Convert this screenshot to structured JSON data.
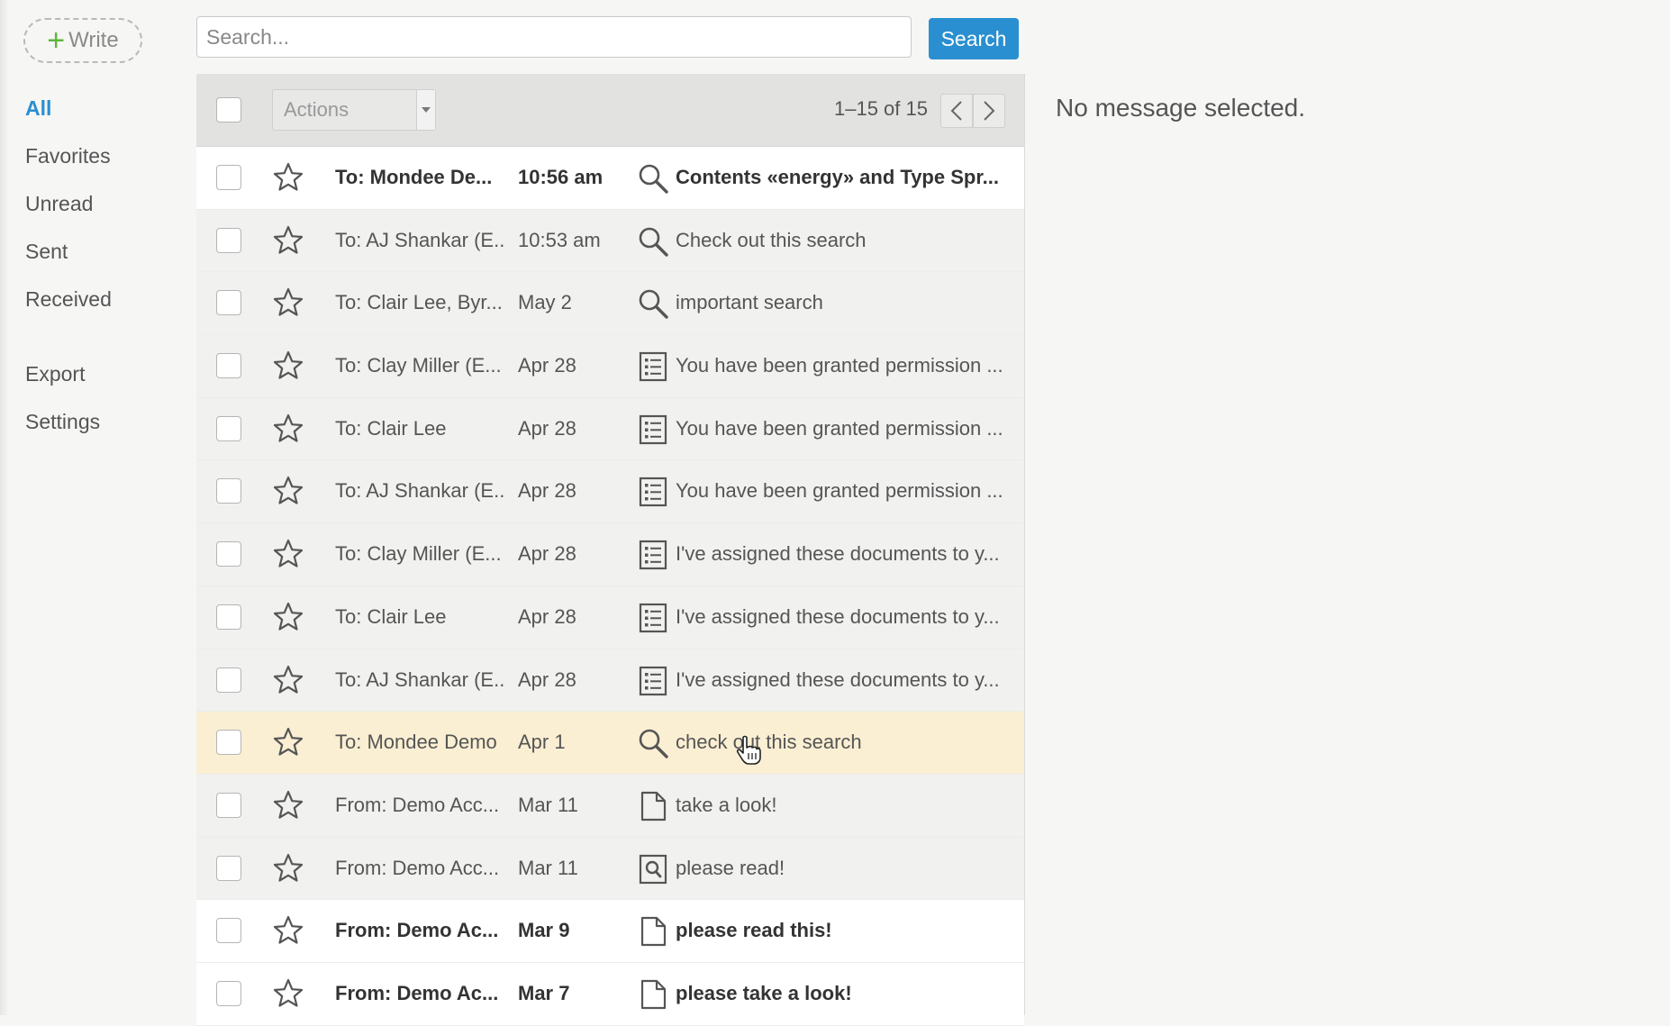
{
  "compose": {
    "label": "Write"
  },
  "search": {
    "placeholder": "Search...",
    "button_label": "Search"
  },
  "sidebar": {
    "items": [
      {
        "label": "All",
        "active": true
      },
      {
        "label": "Favorites"
      },
      {
        "label": "Unread"
      },
      {
        "label": "Sent"
      },
      {
        "label": "Received"
      }
    ],
    "secondary": [
      {
        "label": "Export"
      },
      {
        "label": "Settings"
      }
    ]
  },
  "toolbar": {
    "actions_label": "Actions",
    "pager_text": "1–15 of 15"
  },
  "messages": [
    {
      "who": "To: Mondee De...",
      "when": "10:56 am",
      "icon": "search-icon",
      "subject": "Contents «energy» and Type Spr...",
      "unread": true
    },
    {
      "who": "To: AJ Shankar (E...",
      "when": "10:53 am",
      "icon": "search-icon",
      "subject": "Check out this search"
    },
    {
      "who": "To: Clair Lee, Byr...",
      "when": "May 2",
      "icon": "search-icon",
      "subject": "important search"
    },
    {
      "who": "To: Clay Miller (E...",
      "when": "Apr 28",
      "icon": "list-icon",
      "subject": "You have been granted permission ..."
    },
    {
      "who": "To: Clair Lee",
      "when": "Apr 28",
      "icon": "list-icon",
      "subject": "You have been granted permission ..."
    },
    {
      "who": "To: AJ Shankar (E...",
      "when": "Apr 28",
      "icon": "list-icon",
      "subject": "You have been granted permission ..."
    },
    {
      "who": "To: Clay Miller (E...",
      "when": "Apr 28",
      "icon": "list-icon",
      "subject": "I've assigned these documents to y..."
    },
    {
      "who": "To: Clair Lee",
      "when": "Apr 28",
      "icon": "list-icon",
      "subject": "I've assigned these documents to y..."
    },
    {
      "who": "To: AJ Shankar (E...",
      "when": "Apr 28",
      "icon": "list-icon",
      "subject": "I've assigned these documents to y..."
    },
    {
      "who": "To: Mondee Demo",
      "when": "Apr 1",
      "icon": "search-icon",
      "subject": "check out this search",
      "hover": true
    },
    {
      "who": "From: Demo Acc...",
      "when": "Mar 11",
      "icon": "document-icon",
      "subject": "take a look!"
    },
    {
      "who": "From: Demo Acc...",
      "when": "Mar 11",
      "icon": "document-search-icon",
      "subject": "please read!"
    },
    {
      "who": "From: Demo Ac...",
      "when": "Mar 9",
      "icon": "document-icon",
      "subject": "please read this!",
      "unread": true
    },
    {
      "who": "From: Demo Ac...",
      "when": "Mar 7",
      "icon": "document-icon",
      "subject": "please take a look!",
      "unread": true
    }
  ],
  "preview": {
    "empty_text": "No message selected."
  },
  "colors": {
    "accent": "#2a8fd0",
    "compose_plus": "#5fb53b",
    "hover_row": "#fbefd3"
  }
}
